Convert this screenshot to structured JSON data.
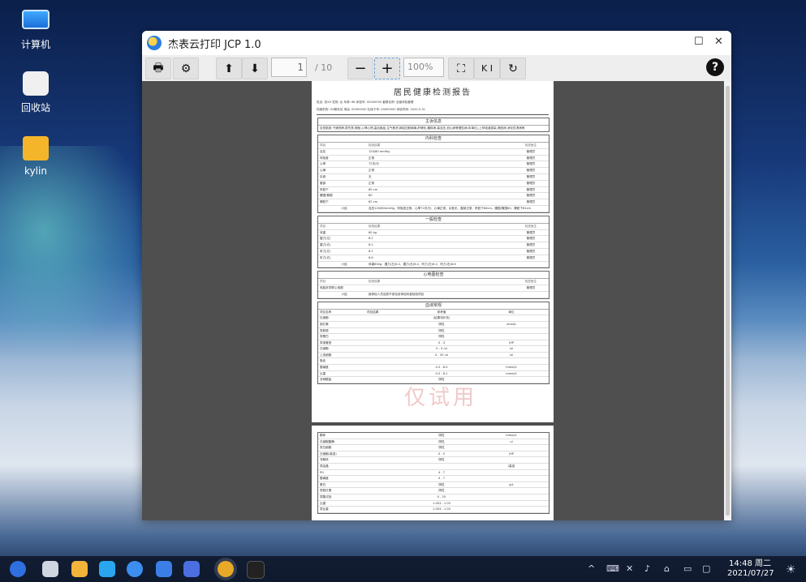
{
  "desktop": {
    "icons": [
      {
        "label": "计算机"
      },
      {
        "label": "回收站"
      },
      {
        "label": "kylin"
      }
    ]
  },
  "window": {
    "title": "杰表云打印 JCP 1.0",
    "toolbar": {
      "page_value": "1",
      "page_count": "/ 10",
      "zoom_value": "100%",
      "zoom_caret": "÷",
      "help_label": "?"
    }
  },
  "document": {
    "title": "居民健康检测报告",
    "info_line1": "姓名: 张XX      性别: 女      年龄: 68      体检号: 00000000      套餐名称: 全面体检套餐",
    "info_line2": "档案机构: XX服务站      电话: 00000000      社保卡号: 00000000      体检时间: 2020-5-31",
    "main_info": {
      "heading": "主诉信息",
      "text": "自觉肌肤,干燥贫瘠,尿失禁,便秘,心悸心慌,高血脂症,生气焦虑,肺癌四肢麻痹,肝硬化,糖尿病,高血压,冠心病等慢性病(本单位),上呼吸道感染,肾脏病,消化性溃疡等"
    },
    "internal": {
      "heading": "内科检查",
      "cols": [
        "项目",
        "检查结果",
        "检查医生"
      ],
      "rows": [
        [
          "血压",
          "120/80 mmHg",
          "管理员"
        ],
        [
          "呼吸音",
          "正常",
          "管理员"
        ],
        [
          "心率",
          "72次/分",
          "管理员"
        ],
        [
          "心律",
          "正常",
          "管理员"
        ],
        [
          "杂音",
          "无",
          "管理员"
        ],
        [
          "腹部",
          "正常",
          "管理员"
        ],
        [
          "肝脏下",
          "60 cm",
          "管理员"
        ],
        [
          "腰围/臀围",
          "60",
          "管理员"
        ],
        [
          "脾脏下",
          "62 cm",
          "管理员"
        ]
      ],
      "summary_label": "小结",
      "summary": "血压120/80mmHg、呼吸音正常、心率72次/分、心律正常、杂音无、腹部正常、肝脏下60cm、腰围/臀围60、脾脏下62cm"
    },
    "general": {
      "heading": "一般检查",
      "cols": [
        "项目",
        "检查结果",
        "检查医生"
      ],
      "rows": [
        [
          "体重",
          "60 kg",
          "管理员"
        ],
        [
          "握力(左)",
          "6.2",
          "管理员"
        ],
        [
          "握力(右)",
          "6.2",
          "管理员"
        ],
        [
          "听力(左)",
          "6.2",
          "管理员"
        ],
        [
          "听力(右)",
          "6.6",
          "管理员"
        ]
      ],
      "summary_label": "小结",
      "summary": "体重60kg、握力(左)6.2、握力(右)6.2、听力(左)6.2、听力(右)6.6"
    },
    "ecg": {
      "heading": "心电图检查",
      "cols": [
        "项目",
        "检查结果",
        "检查医生"
      ],
      "rows": [
        [
          "电脑多导联心电图",
          "",
          "管理员"
        ]
      ],
      "summary_label": "小结",
      "summary": "被体检人员自愿不参加该体检科室检验项目"
    },
    "blood": {
      "heading": "血液常规",
      "cols": [
        "项目名称",
        "项目结果",
        "参考值",
        "单位"
      ],
      "rows": [
        [
          "红细胞",
          "",
          "(结果待补充)",
          ""
        ],
        [
          "胆红素",
          "",
          "阴性",
          "umol/L"
        ],
        [
          "尿胆原",
          "",
          "阴性",
          ""
        ],
        [
          "尿蛋白",
          "",
          "阴性",
          ""
        ],
        [
          "尿液管型",
          "",
          "0 - 3",
          "/HP"
        ],
        [
          "白细胞",
          "",
          "0 - 5 /ul",
          "/ul"
        ],
        [
          "上皮细胞",
          "",
          "0 - 20 /ul",
          "/ul"
        ],
        [
          "隐血",
          "",
          "",
          ""
        ],
        [
          "酸碱度",
          "",
          "4.5 - 8.0",
          "mmol/L"
        ],
        [
          "比重",
          "",
          "4.5 - 6.1",
          "mmol/L"
        ],
        [
          "亚硝酸盐",
          "",
          "阴性",
          ""
        ]
      ],
      "watermark": "仅试用"
    },
    "page2": {
      "rows": [
        [
          "酮体",
          "",
          "阴性",
          "mmol/L"
        ],
        [
          "白细胞酯酶",
          "",
          "阴性",
          "ul"
        ],
        [
          "尿白细胞",
          "",
          "阴性",
          ""
        ],
        [
          "白细胞(高倍)",
          "",
          "0 - 5",
          "/HP"
        ],
        [
          "非鳞状",
          "",
          "阴性",
          ""
        ],
        [
          "尿结晶",
          "",
          "",
          "/高倍"
        ],
        [
          "PH",
          "",
          "4 - 7",
          ""
        ],
        [
          "酸碱度",
          "",
          "4 - 7",
          ""
        ],
        [
          "蛋白",
          "",
          "阴性",
          "g/L"
        ],
        [
          "尿胆红素",
          "",
          "阴性",
          ""
        ],
        [
          "尿酸试验",
          "",
          "0 - 25",
          ""
        ],
        [
          "比重",
          "",
          "1.003 - 1.03",
          ""
        ],
        [
          "尿比重",
          "",
          "1.003 - 1.03",
          ""
        ]
      ]
    }
  },
  "taskbar": {
    "time": "14:48 周二",
    "date": "2021/07/27"
  }
}
